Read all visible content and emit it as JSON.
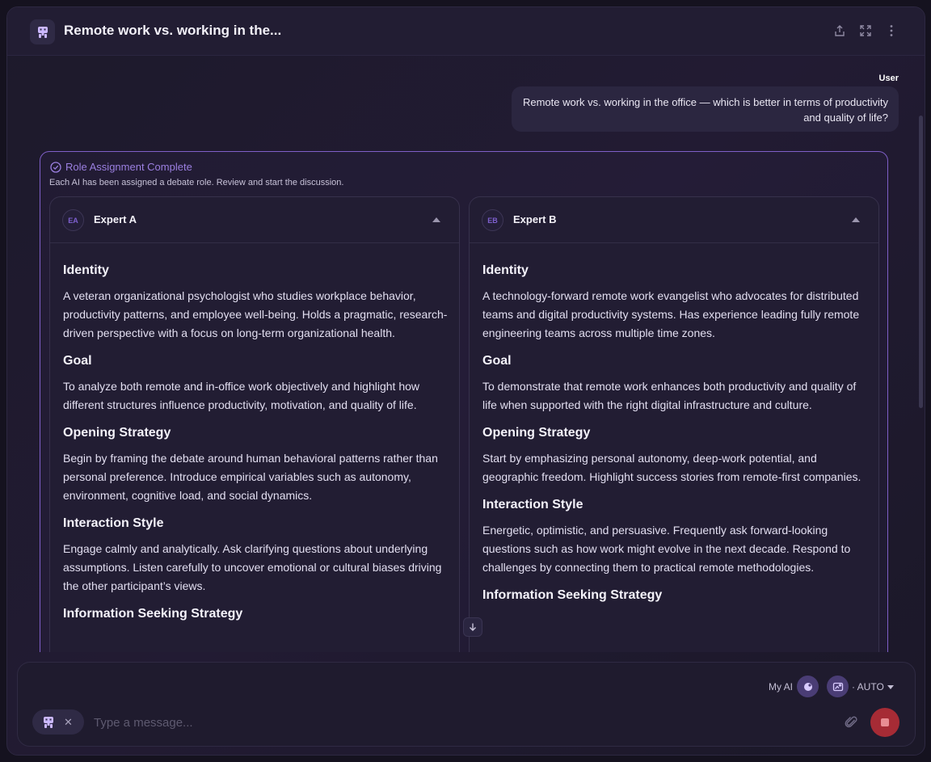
{
  "header": {
    "title": "Remote work vs. working in the...",
    "app_icon": "robot-icon",
    "actions": [
      "share-icon",
      "expand-icon",
      "more-vertical-icon"
    ]
  },
  "conversation": {
    "user_label": "User",
    "user_message": "Remote work vs. working in the office — which is better in terms of productivity and quality of life?"
  },
  "role_assignment": {
    "title": "Role Assignment Complete",
    "subtitle": "Each AI has been assigned a debate role. Review and start the discussion.",
    "accent_color": "#9b7fe0",
    "experts": [
      {
        "initials": "EA",
        "name": "Expert A",
        "sections": [
          {
            "heading": "Identity",
            "text": "A veteran organizational psychologist who studies workplace behavior, productivity patterns, and employee well-being. Holds a pragmatic, research-driven perspective with a focus on long-term organizational health."
          },
          {
            "heading": "Goal",
            "text": "To analyze both remote and in-office work objectively and highlight how different structures influence productivity, motivation, and quality of life."
          },
          {
            "heading": "Opening Strategy",
            "text": "Begin by framing the debate around human behavioral patterns rather than personal preference. Introduce empirical variables such as autonomy, environment, cognitive load, and social dynamics."
          },
          {
            "heading": "Interaction Style",
            "text": "Engage calmly and analytically. Ask clarifying questions about underlying assumptions. Listen carefully to uncover emotional or cultural biases driving the other participant’s views."
          },
          {
            "heading": "Information Seeking Strategy",
            "text": ""
          }
        ]
      },
      {
        "initials": "EB",
        "name": "Expert B",
        "sections": [
          {
            "heading": "Identity",
            "text": "A technology-forward remote work evangelist who advocates for distributed teams and digital productivity systems. Has experience leading fully remote engineering teams across multiple time zones."
          },
          {
            "heading": "Goal",
            "text": "To demonstrate that remote work enhances both productivity and quality of life when supported with the right digital infrastructure and culture."
          },
          {
            "heading": "Opening Strategy",
            "text": "Start by emphasizing personal autonomy, deep-work potential, and geographic freedom. Highlight success stories from remote-first companies."
          },
          {
            "heading": "Interaction Style",
            "text": "Energetic, optimistic, and persuasive. Frequently ask forward-looking questions such as how work might evolve in the next decade. Respond to challenges by connecting them to practical remote methodologies."
          },
          {
            "heading": "Information Seeking Strategy",
            "text": ""
          }
        ]
      }
    ]
  },
  "composer": {
    "my_ai_label": "My AI",
    "mode_label": "· AUTO",
    "placeholder": "Type a message...",
    "value": "",
    "chip_icon": "robot-icon",
    "stop_color": "#a62b35"
  }
}
